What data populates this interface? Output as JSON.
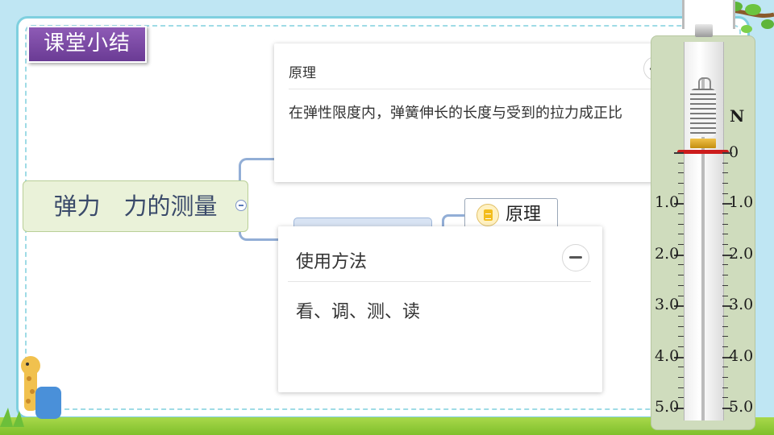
{
  "slide": {
    "title": "课堂小结"
  },
  "mindmap": {
    "root_label": "弹力　力的测量",
    "sub_node_label": "原理"
  },
  "cards": [
    {
      "title": "原理",
      "body": "在弹性限度内，弹簧伸长的长度与受到的拉力成正比"
    },
    {
      "title": "使用方法",
      "body": "看、调、测、读"
    }
  ],
  "spring_scale": {
    "unit": "N",
    "zero_label": "0",
    "left_labels": [
      "1.0",
      "2.0",
      "3.0",
      "4.0",
      "5.0"
    ],
    "right_labels": [
      "1.0",
      "2.0",
      "3.0",
      "4.0",
      "5.0"
    ],
    "pointer_reading": 0
  },
  "icons": {
    "collapse": "minus-circle-icon",
    "note": "note-icon"
  },
  "colors": {
    "title_badge": "#7a4aa4",
    "frame_border": "#7fd0df",
    "root_node_bg": "#eaf2d9",
    "pointer": "#cc1c1c"
  }
}
